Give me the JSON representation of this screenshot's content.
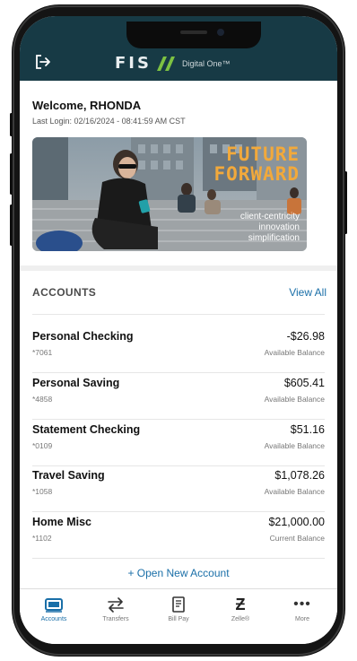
{
  "header": {
    "brand_logo": "FIS",
    "brand_product": "Digital One™",
    "logout_icon": "logout-icon"
  },
  "welcome": {
    "title": "Welcome, RHONDA",
    "last_login": "Last Login: 02/16/2024 - 08:41:59 AM CST"
  },
  "banner": {
    "headline_line1": "FUTURE",
    "headline_line2": "FORWARD",
    "tagline_1": "client-centricity",
    "tagline_2": "innovation",
    "tagline_3": "simplification",
    "accent_color": "#f2a93b"
  },
  "accounts": {
    "section_title": "ACCOUNTS",
    "view_all_label": "View All",
    "items": [
      {
        "name": "Personal Checking",
        "number": "*7061",
        "balance": "-$26.98",
        "balance_label": "Available Balance"
      },
      {
        "name": "Personal Saving",
        "number": "*4858",
        "balance": "$605.41",
        "balance_label": "Available Balance"
      },
      {
        "name": "Statement Checking",
        "number": "*0109",
        "balance": "$51.16",
        "balance_label": "Available Balance"
      },
      {
        "name": "Travel Saving",
        "number": "*1058",
        "balance": "$1,078.26",
        "balance_label": "Available Balance"
      },
      {
        "name": "Home Misc",
        "number": "*1102",
        "balance": "$21,000.00",
        "balance_label": "Current Balance"
      }
    ],
    "open_new_label": "+ Open New Account"
  },
  "nav": {
    "items": [
      {
        "label": "Accounts",
        "icon": "accounts-icon",
        "active": true
      },
      {
        "label": "Transfers",
        "icon": "transfers-icon",
        "active": false
      },
      {
        "label": "Bill Pay",
        "icon": "bill-pay-icon",
        "active": false
      },
      {
        "label": "Zelle®",
        "icon": "zelle-icon",
        "active": false
      },
      {
        "label": "More",
        "icon": "more-icon",
        "active": false
      }
    ]
  },
  "colors": {
    "header_bg": "#173a45",
    "link": "#1a6fa8",
    "brand_green": "#7dc242"
  }
}
